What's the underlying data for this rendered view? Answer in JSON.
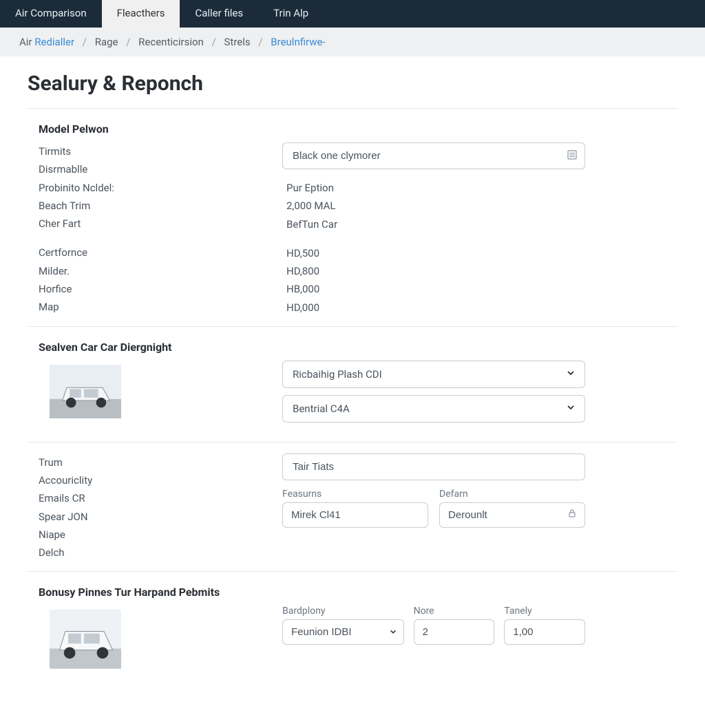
{
  "topnav": {
    "tabs": [
      {
        "label": "Air Comparison"
      },
      {
        "label": "Fleacthers"
      },
      {
        "label": "Caller files"
      },
      {
        "label": "Trin Alp"
      }
    ],
    "active_index": 1
  },
  "breadcrumb": {
    "prefix": "Air",
    "items": [
      "Redialler",
      "Rage",
      "Recenticirsion",
      "Strels",
      "Breulnfirwe-"
    ]
  },
  "page_title": "Sealury & Reponch",
  "section1": {
    "heading": "Model Pelwon",
    "left_labels": [
      "Tirmits",
      "Disrmablle",
      "Probinito Ncldel:",
      "Beach Trim",
      "Cher Fart"
    ],
    "left_labels2": [
      "Certfornce",
      "Milder.",
      "Horfice",
      "Map"
    ],
    "input_value": "Black one clymorer",
    "right_vals": [
      "Pur Eption",
      "2,000 MAL",
      "BefTun Car"
    ],
    "right_vals2": [
      "HD,500",
      "HD,800",
      "HB,000",
      "HD,000"
    ]
  },
  "section2": {
    "heading": "Sealven Car Car Diergnight",
    "image_name": "car-suv-white",
    "dropdown1": "Ricbaihig Plash CDI",
    "dropdown2": "Bentrial C4A",
    "left_labels": [
      "Trum",
      "Accouriclity",
      "Emails CR",
      "Spear JON",
      "Niape",
      "Delch"
    ],
    "text_input": "Tair Tiats",
    "pair": {
      "label1": "Feasurns",
      "value1": "Mirek Cl41",
      "label2": "Defarn",
      "value2": "Derounlt"
    }
  },
  "section3": {
    "heading": "Bonusy Pinnes Tur Harpand Pebmits",
    "image_name": "car-mpv-white",
    "fields": {
      "label1": "Bardplony",
      "value1": "Feunion IDBI",
      "label2": "Nore",
      "value2": "2",
      "label3": "Tanely",
      "value3": "1,00"
    }
  },
  "icons": {
    "rows": "rows-icon",
    "lock": "lock-icon",
    "chevron": "chevron-down-icon"
  }
}
